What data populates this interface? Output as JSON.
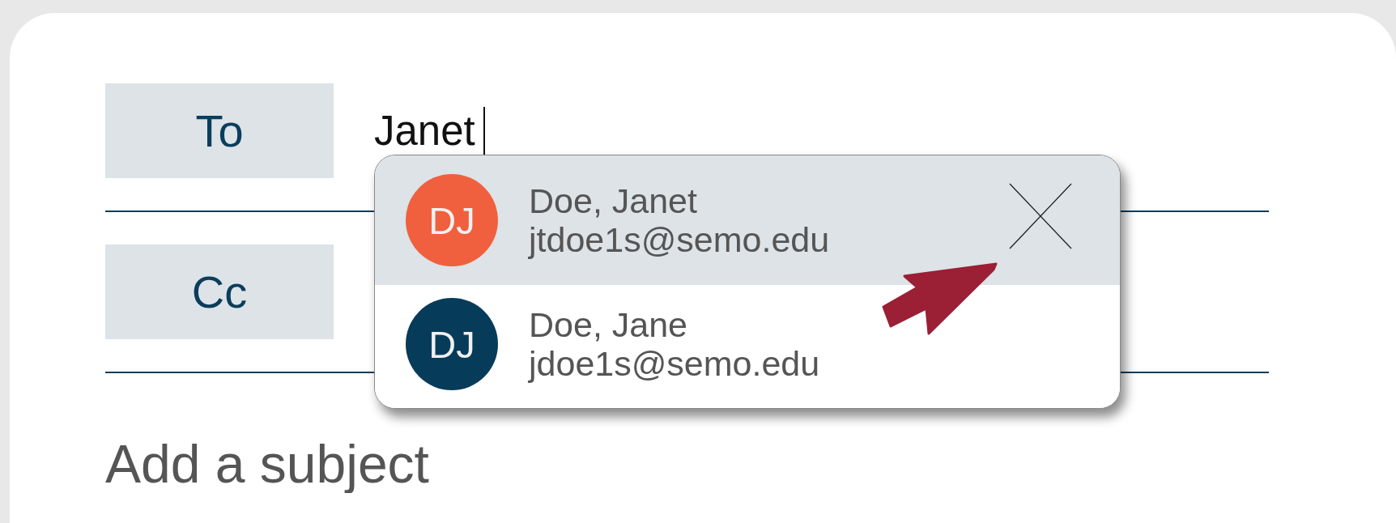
{
  "fields": [
    {
      "label": "To",
      "value": "Janet"
    },
    {
      "label": "Cc"
    }
  ],
  "subject": {
    "placeholder": "Add a subject"
  },
  "suggestions": [
    {
      "initials": "DJ",
      "name": "Doe, Janet",
      "email": "jtdoe1s@semo.edu",
      "color": "#f0603e",
      "selected": true,
      "removable": true
    },
    {
      "initials": "DJ",
      "name": "Doe, Jane",
      "email": "jdoe1s@semo.edu",
      "color": "#073b5a",
      "selected": false,
      "removable": false
    }
  ],
  "pointer": {
    "visible": true
  }
}
